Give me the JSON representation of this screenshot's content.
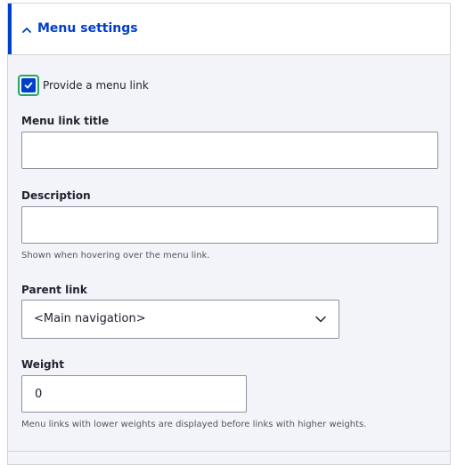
{
  "section": {
    "title": "Menu settings"
  },
  "provide_menu_link": {
    "label": "Provide a menu link",
    "checked": true
  },
  "menu_link_title": {
    "label": "Menu link title",
    "value": ""
  },
  "description": {
    "label": "Description",
    "value": "",
    "help": "Shown when hovering over the menu link."
  },
  "parent_link": {
    "label": "Parent link",
    "selected": "<Main navigation>"
  },
  "weight": {
    "label": "Weight",
    "value": "0",
    "help": "Menu links with lower weights are displayed before links with higher weights."
  },
  "colors": {
    "accent": "#003ecc",
    "focus_ring": "#26a769",
    "panel_bg": "#f3f4f9"
  }
}
